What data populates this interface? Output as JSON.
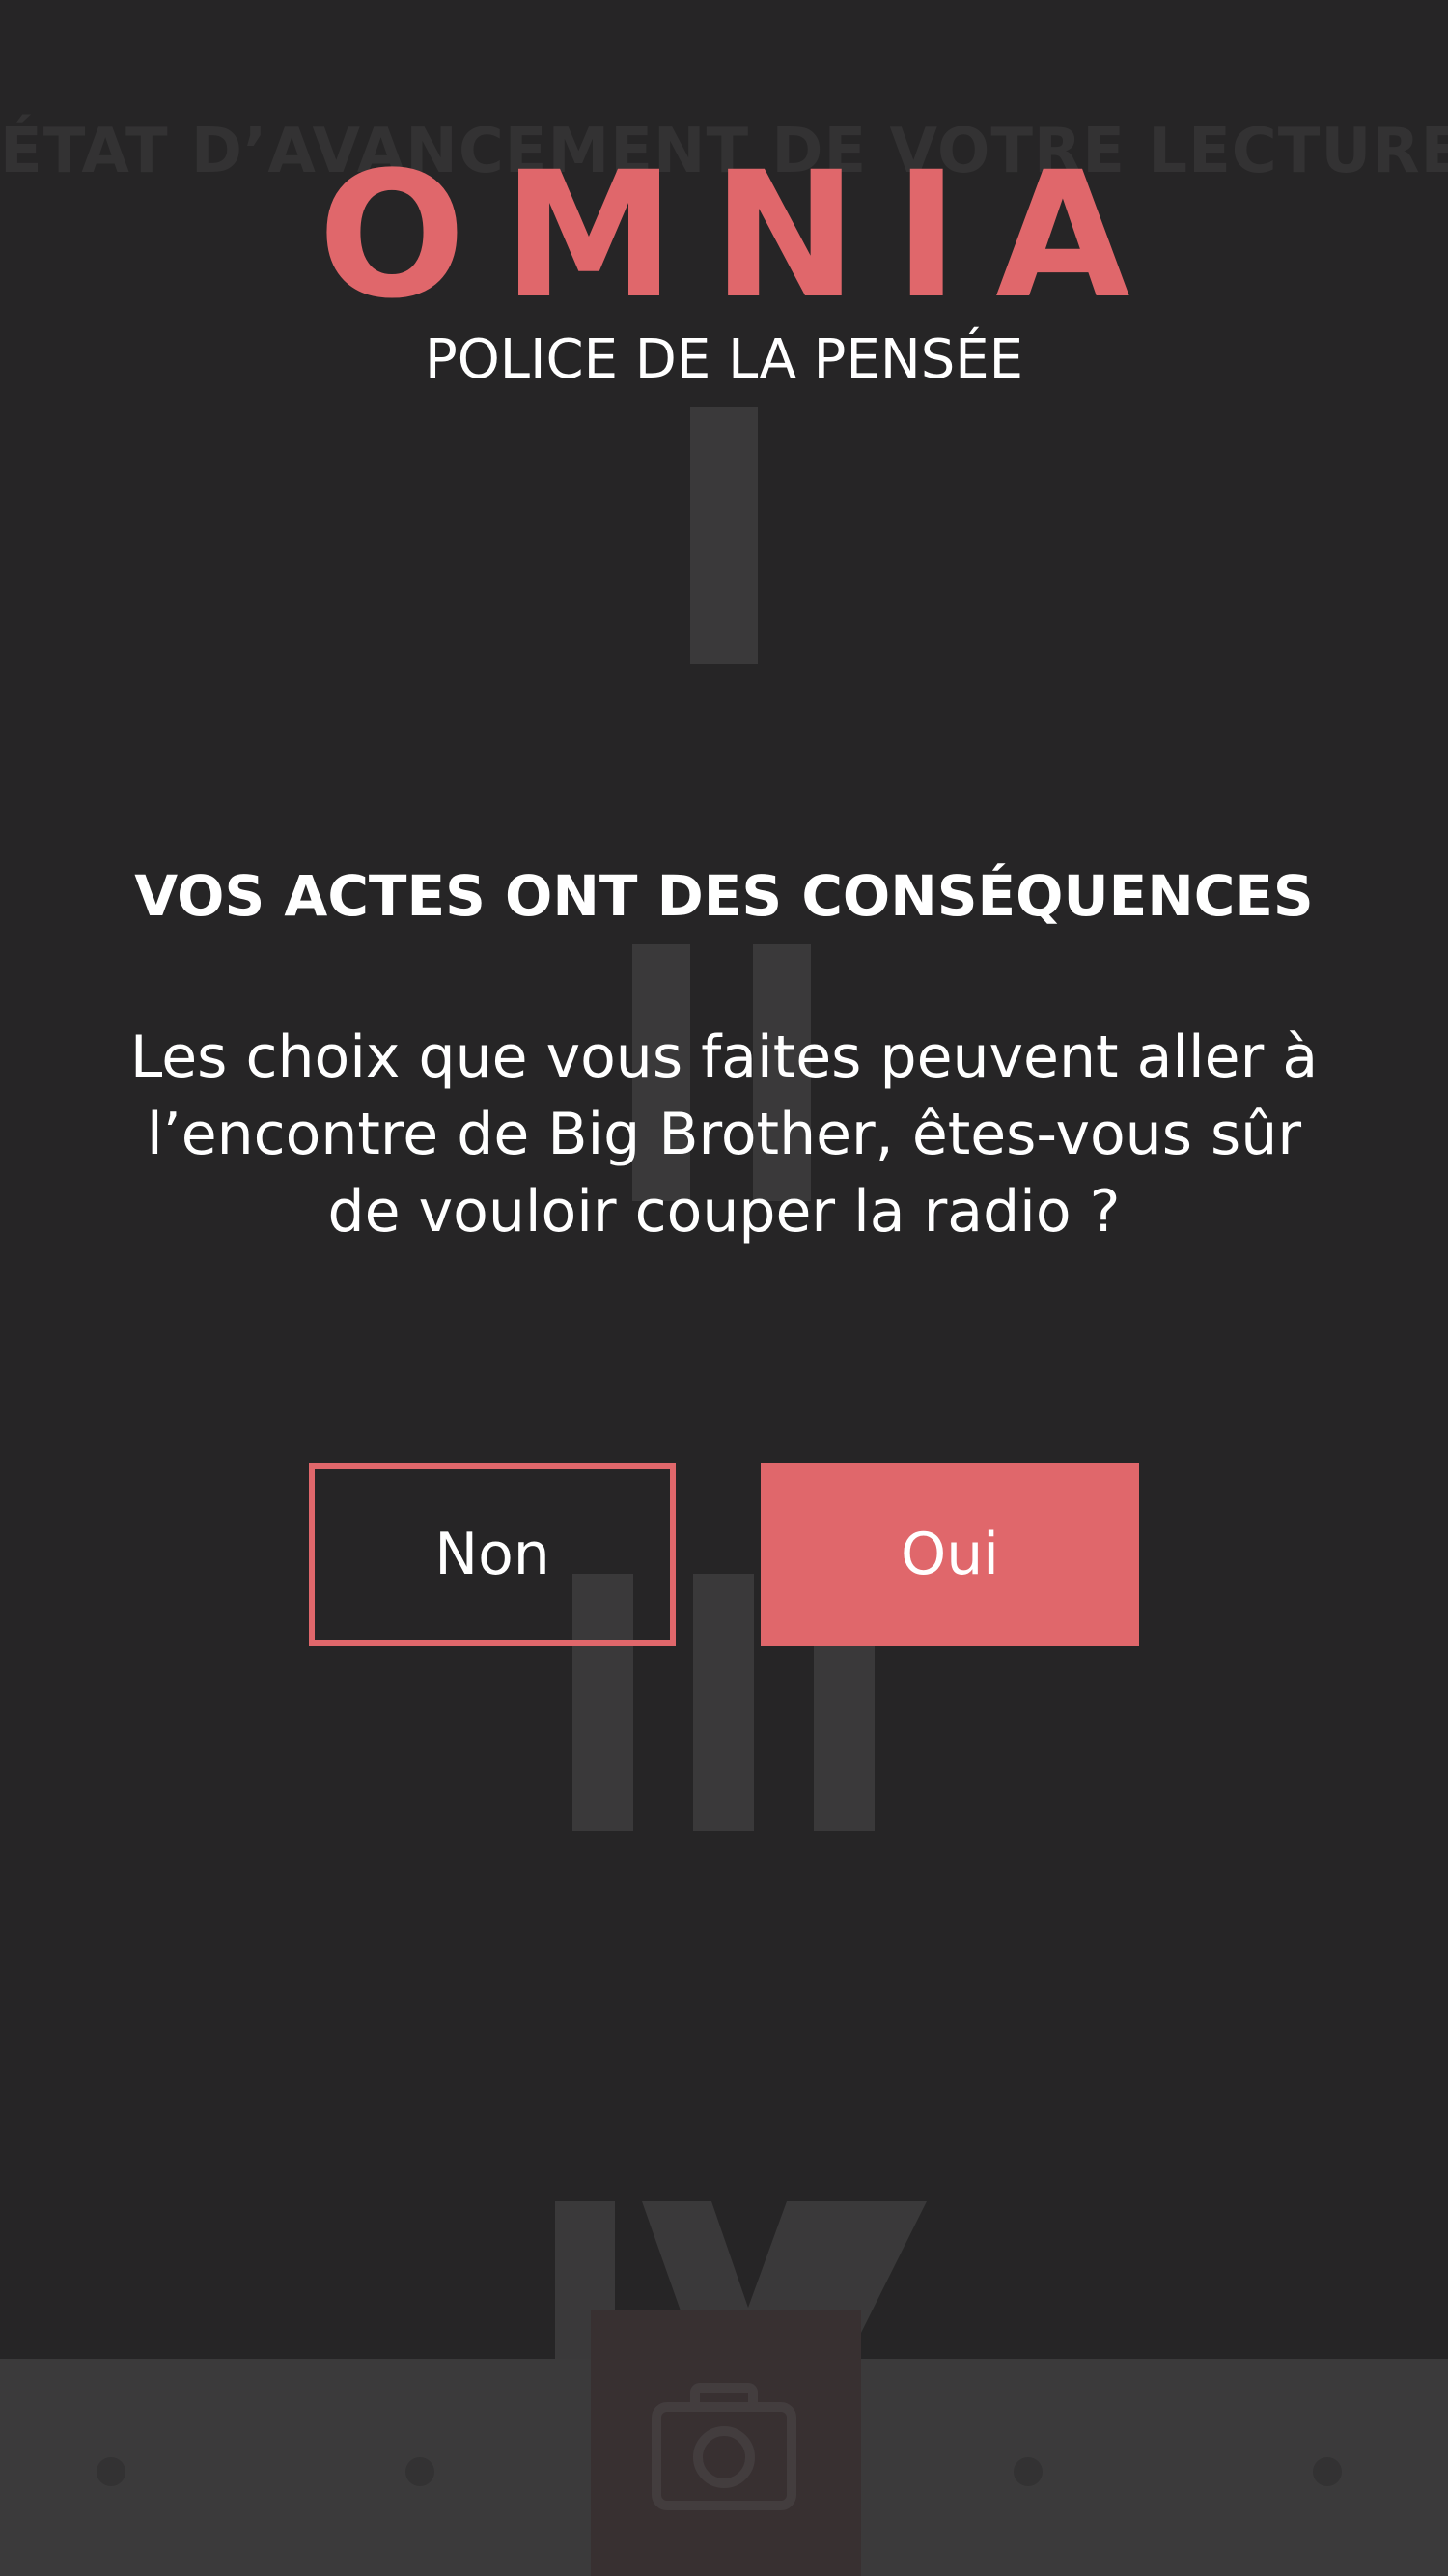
{
  "background": {
    "progress_title": "ÉTAT D’AVANCEMENT DE VOTRE LECTURE",
    "chapters": [
      "I",
      "II",
      "III",
      "IV"
    ],
    "bottom_nav": {
      "center_icon": "camera-icon"
    }
  },
  "header": {
    "brand": "OMNIA",
    "subtitle": "POLICE DE LA PENSÉE"
  },
  "dialog": {
    "title": "VOS ACTES ONT DES CONSÉQUENCES",
    "message": "Les choix que vous faites peuvent aller à l’encontre de Big Brother, êtes-vous sûr de vouloir couper la radio ?",
    "cancel_label": "Non",
    "confirm_label": "Oui"
  },
  "colors": {
    "accent": "#e0676b",
    "background": "#262526",
    "text": "#ffffff"
  }
}
